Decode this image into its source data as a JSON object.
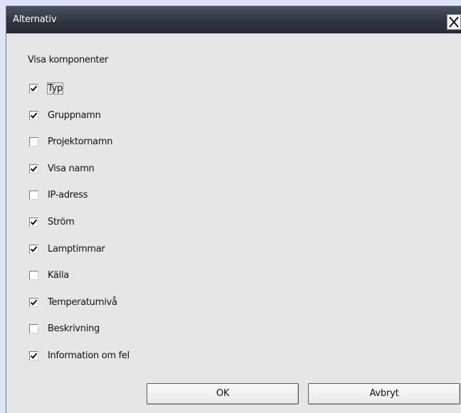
{
  "window": {
    "title": "Alternativ",
    "close_icon": "close-icon"
  },
  "section_heading": "Visa komponenter",
  "components": [
    {
      "label": "Typ",
      "checked": true,
      "focused": true
    },
    {
      "label": "Gruppnamn",
      "checked": true
    },
    {
      "label": "Projektornamn",
      "checked": false
    },
    {
      "label": "Visa namn",
      "checked": true
    },
    {
      "label": "IP-adress",
      "checked": false
    },
    {
      "label": "Ström",
      "checked": true
    },
    {
      "label": "Lamptimmar",
      "checked": true
    },
    {
      "label": "Källa",
      "checked": false
    },
    {
      "label": "Temperaturnivå",
      "checked": true
    },
    {
      "label": "Beskrivning",
      "checked": false
    },
    {
      "label": "Information om fel",
      "checked": true
    }
  ],
  "buttons": {
    "ok": "OK",
    "cancel": "Avbryt"
  },
  "colors": {
    "titlebar": "#2e3440",
    "dialog_bg": "#e6e6e6",
    "desktop_bg": "#dfe3f7"
  }
}
